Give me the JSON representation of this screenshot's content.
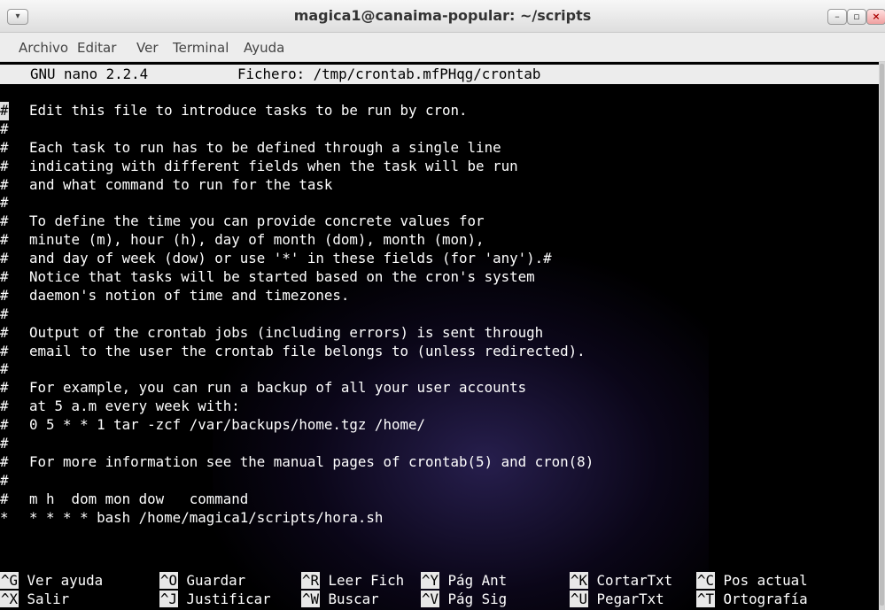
{
  "window": {
    "title": "magica1@canaima-popular: ~/scripts",
    "menu_button": "▾",
    "minimize": "–",
    "maximize": "▫",
    "close": "×"
  },
  "menu": [
    "Archivo",
    "Editar",
    "Ver",
    "Terminal",
    "Ayuda"
  ],
  "nano": {
    "version": "GNU nano 2.2.4",
    "file": "Fichero: /tmp/crontab.mfPHqg/crontab"
  },
  "lines": [
    {
      "hash": "#",
      "text": "Edit this file to introduce tasks to be run by cron."
    },
    {
      "hash": "#",
      "text": ""
    },
    {
      "hash": "#",
      "text": "Each task to run has to be defined through a single line"
    },
    {
      "hash": "#",
      "text": "indicating with different fields when the task will be run"
    },
    {
      "hash": "#",
      "text": "and what command to run for the task"
    },
    {
      "hash": "#",
      "text": ""
    },
    {
      "hash": "#",
      "text": "To define the time you can provide concrete values for"
    },
    {
      "hash": "#",
      "text": "minute (m), hour (h), day of month (dom), month (mon),"
    },
    {
      "hash": "#",
      "text": "and day of week (dow) or use '*' in these fields (for 'any').#"
    },
    {
      "hash": "#",
      "text": "Notice that tasks will be started based on the cron's system"
    },
    {
      "hash": "#",
      "text": "daemon's notion of time and timezones."
    },
    {
      "hash": "#",
      "text": ""
    },
    {
      "hash": "#",
      "text": "Output of the crontab jobs (including errors) is sent through"
    },
    {
      "hash": "#",
      "text": "email to the user the crontab file belongs to (unless redirected)."
    },
    {
      "hash": "#",
      "text": ""
    },
    {
      "hash": "#",
      "text": "For example, you can run a backup of all your user accounts"
    },
    {
      "hash": "#",
      "text": "at 5 a.m every week with:"
    },
    {
      "hash": "#",
      "text": "0 5 * * 1 tar -zcf /var/backups/home.tgz /home/"
    },
    {
      "hash": "#",
      "text": ""
    },
    {
      "hash": "#",
      "text": "For more information see the manual pages of crontab(5) and cron(8)"
    },
    {
      "hash": "#",
      "text": ""
    },
    {
      "hash": "#",
      "text": "m h  dom mon dow   command"
    },
    {
      "hash": "*",
      "text": "* * * * bash /home/magica1/scripts/hora.sh"
    }
  ],
  "shortcuts_row1": [
    {
      "key": "^G",
      "label": "Ver ayuda"
    },
    {
      "key": "^O",
      "label": "Guardar"
    },
    {
      "key": "^R",
      "label": "Leer Fich"
    },
    {
      "key": "^Y",
      "label": "Pág Ant"
    },
    {
      "key": "^K",
      "label": "CortarTxt"
    },
    {
      "key": "^C",
      "label": "Pos actual"
    }
  ],
  "shortcuts_row2": [
    {
      "key": "^X",
      "label": "Salir"
    },
    {
      "key": "^J",
      "label": "Justificar"
    },
    {
      "key": "^W",
      "label": "Buscar"
    },
    {
      "key": "^V",
      "label": "Pág Sig"
    },
    {
      "key": "^U",
      "label": "PegarTxt"
    },
    {
      "key": "^T",
      "label": "Ortografía"
    }
  ]
}
